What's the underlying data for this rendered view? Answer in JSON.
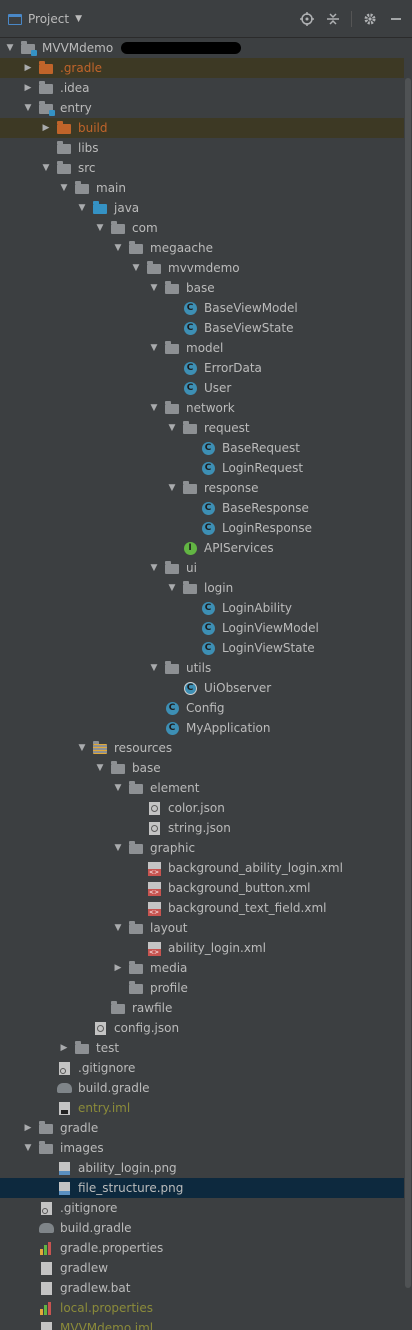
{
  "toolbar": {
    "title": "Project",
    "dropdown": "▼",
    "buttons": [
      "locate-icon",
      "collapse-icon",
      "gear-icon",
      "minimize-icon"
    ]
  },
  "tree": [
    {
      "label": "MVVMdemo",
      "depth": 0,
      "arrow": "down",
      "icon": "module-folder",
      "redacted": true
    },
    {
      "label": ".gradle",
      "depth": 1,
      "arrow": "right",
      "icon": "folder-orange",
      "style": "excluded",
      "hl": "gradle"
    },
    {
      "label": ".idea",
      "depth": 1,
      "arrow": "right",
      "icon": "folder"
    },
    {
      "label": "entry",
      "depth": 1,
      "arrow": "down",
      "icon": "module-folder"
    },
    {
      "label": "build",
      "depth": 2,
      "arrow": "right",
      "icon": "folder-orange",
      "style": "excluded",
      "hl": "build"
    },
    {
      "label": "libs",
      "depth": 2,
      "arrow": "none",
      "icon": "folder"
    },
    {
      "label": "src",
      "depth": 2,
      "arrow": "down",
      "icon": "folder"
    },
    {
      "label": "main",
      "depth": 3,
      "arrow": "down",
      "icon": "folder"
    },
    {
      "label": "java",
      "depth": 4,
      "arrow": "down",
      "icon": "folder-blue"
    },
    {
      "label": "com",
      "depth": 5,
      "arrow": "down",
      "icon": "folder"
    },
    {
      "label": "megaache",
      "depth": 6,
      "arrow": "down",
      "icon": "folder"
    },
    {
      "label": "mvvmdemo",
      "depth": 7,
      "arrow": "down",
      "icon": "folder"
    },
    {
      "label": "base",
      "depth": 8,
      "arrow": "down",
      "icon": "folder"
    },
    {
      "label": "BaseViewModel",
      "depth": 9,
      "arrow": "none",
      "icon": "class"
    },
    {
      "label": "BaseViewState",
      "depth": 9,
      "arrow": "none",
      "icon": "class"
    },
    {
      "label": "model",
      "depth": 8,
      "arrow": "down",
      "icon": "folder"
    },
    {
      "label": "ErrorData",
      "depth": 9,
      "arrow": "none",
      "icon": "class"
    },
    {
      "label": "User",
      "depth": 9,
      "arrow": "none",
      "icon": "class"
    },
    {
      "label": "network",
      "depth": 8,
      "arrow": "down",
      "icon": "folder"
    },
    {
      "label": "request",
      "depth": 9,
      "arrow": "down",
      "icon": "folder"
    },
    {
      "label": "BaseRequest",
      "depth": 10,
      "arrow": "none",
      "icon": "class"
    },
    {
      "label": "LoginRequest",
      "depth": 10,
      "arrow": "none",
      "icon": "class"
    },
    {
      "label": "response",
      "depth": 9,
      "arrow": "down",
      "icon": "folder"
    },
    {
      "label": "BaseResponse",
      "depth": 10,
      "arrow": "none",
      "icon": "class"
    },
    {
      "label": "LoginResponse",
      "depth": 10,
      "arrow": "none",
      "icon": "class"
    },
    {
      "label": "APIServices",
      "depth": 9,
      "arrow": "none",
      "icon": "interface"
    },
    {
      "label": "ui",
      "depth": 8,
      "arrow": "down",
      "icon": "folder"
    },
    {
      "label": "login",
      "depth": 9,
      "arrow": "down",
      "icon": "folder"
    },
    {
      "label": "LoginAbility",
      "depth": 10,
      "arrow": "none",
      "icon": "class"
    },
    {
      "label": "LoginViewModel",
      "depth": 10,
      "arrow": "none",
      "icon": "class"
    },
    {
      "label": "LoginViewState",
      "depth": 10,
      "arrow": "none",
      "icon": "class"
    },
    {
      "label": "utils",
      "depth": 8,
      "arrow": "down",
      "icon": "folder"
    },
    {
      "label": "UiObserver",
      "depth": 9,
      "arrow": "none",
      "icon": "class-abstract"
    },
    {
      "label": "Config",
      "depth": 8,
      "arrow": "none",
      "icon": "class"
    },
    {
      "label": "MyApplication",
      "depth": 8,
      "arrow": "none",
      "icon": "class"
    },
    {
      "label": "resources",
      "depth": 4,
      "arrow": "down",
      "icon": "folder-res"
    },
    {
      "label": "base",
      "depth": 5,
      "arrow": "down",
      "icon": "folder"
    },
    {
      "label": "element",
      "depth": 6,
      "arrow": "down",
      "icon": "folder"
    },
    {
      "label": "color.json",
      "depth": 7,
      "arrow": "none",
      "icon": "json"
    },
    {
      "label": "string.json",
      "depth": 7,
      "arrow": "none",
      "icon": "json"
    },
    {
      "label": "graphic",
      "depth": 6,
      "arrow": "down",
      "icon": "folder"
    },
    {
      "label": "background_ability_login.xml",
      "depth": 7,
      "arrow": "none",
      "icon": "xml"
    },
    {
      "label": "background_button.xml",
      "depth": 7,
      "arrow": "none",
      "icon": "xml"
    },
    {
      "label": "background_text_field.xml",
      "depth": 7,
      "arrow": "none",
      "icon": "xml"
    },
    {
      "label": "layout",
      "depth": 6,
      "arrow": "down",
      "icon": "folder"
    },
    {
      "label": "ability_login.xml",
      "depth": 7,
      "arrow": "none",
      "icon": "xml"
    },
    {
      "label": "media",
      "depth": 6,
      "arrow": "right",
      "icon": "folder"
    },
    {
      "label": "profile",
      "depth": 6,
      "arrow": "none",
      "icon": "folder"
    },
    {
      "label": "rawfile",
      "depth": 5,
      "arrow": "none",
      "icon": "folder"
    },
    {
      "label": "config.json",
      "depth": 4,
      "arrow": "none",
      "icon": "json"
    },
    {
      "label": "test",
      "depth": 3,
      "arrow": "right",
      "icon": "folder"
    },
    {
      "label": ".gitignore",
      "depth": 2,
      "arrow": "none",
      "icon": "gitignore"
    },
    {
      "label": "build.gradle",
      "depth": 2,
      "arrow": "none",
      "icon": "gradle"
    },
    {
      "label": "entry.iml",
      "depth": 2,
      "arrow": "none",
      "icon": "iml",
      "style": "ignored"
    },
    {
      "label": "gradle",
      "depth": 1,
      "arrow": "right",
      "icon": "folder"
    },
    {
      "label": "images",
      "depth": 1,
      "arrow": "down",
      "icon": "folder"
    },
    {
      "label": "ability_login.png",
      "depth": 2,
      "arrow": "none",
      "icon": "png"
    },
    {
      "label": "file_structure.png",
      "depth": 2,
      "arrow": "none",
      "icon": "png",
      "selected": true
    },
    {
      "label": ".gitignore",
      "depth": 1,
      "arrow": "none",
      "icon": "gitignore"
    },
    {
      "label": "build.gradle",
      "depth": 1,
      "arrow": "none",
      "icon": "gradle"
    },
    {
      "label": "gradle.properties",
      "depth": 1,
      "arrow": "none",
      "icon": "properties"
    },
    {
      "label": "gradlew",
      "depth": 1,
      "arrow": "none",
      "icon": "doc"
    },
    {
      "label": "gradlew.bat",
      "depth": 1,
      "arrow": "none",
      "icon": "doc"
    },
    {
      "label": "local.properties",
      "depth": 1,
      "arrow": "none",
      "icon": "properties",
      "style": "ignored"
    },
    {
      "label": "MVVMdemo.iml",
      "depth": 1,
      "arrow": "none",
      "icon": "iml",
      "style": "ignored"
    }
  ]
}
